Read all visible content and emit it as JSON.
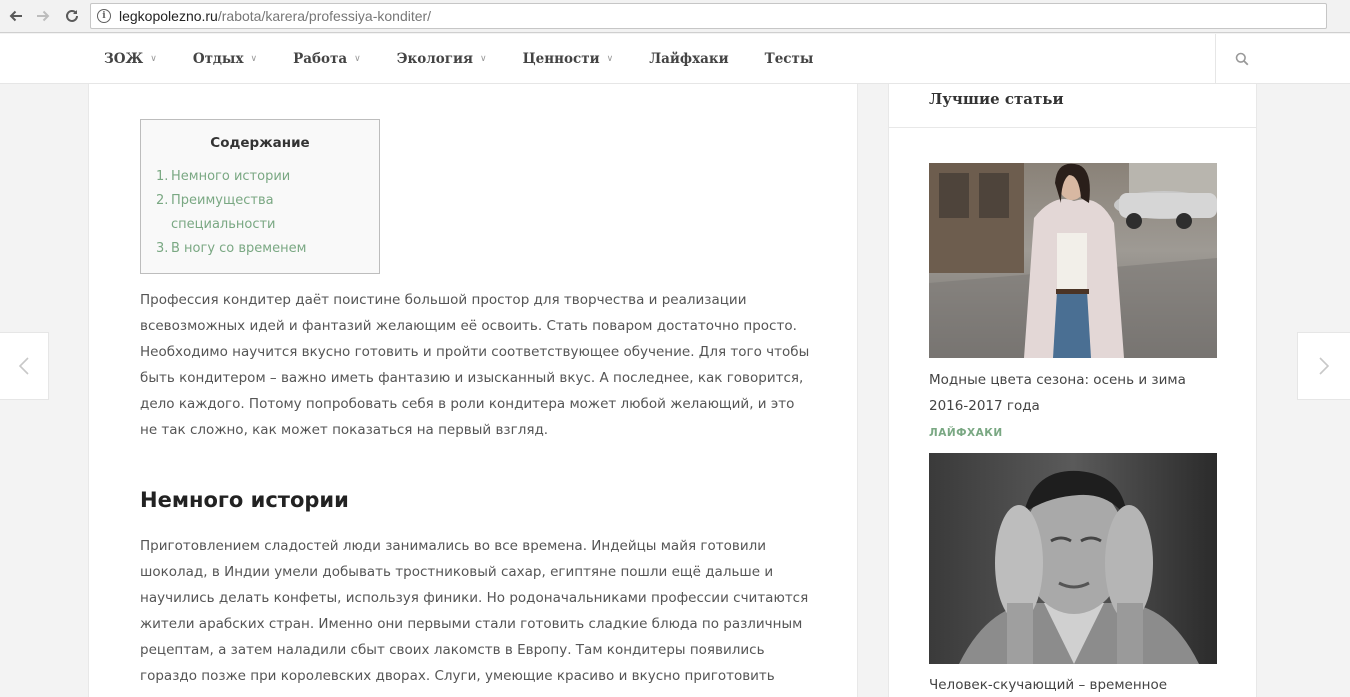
{
  "browser": {
    "url_domain": "legkopolezno.ru",
    "url_path": "/rabota/karera/professiya-konditer/",
    "info_glyph": "i"
  },
  "menu": [
    {
      "label": "ЗОЖ",
      "chevron": "∨"
    },
    {
      "label": "Отдых",
      "chevron": "∨"
    },
    {
      "label": "Работа",
      "chevron": "∨"
    },
    {
      "label": "Экология",
      "chevron": "∨"
    },
    {
      "label": "Ценности",
      "chevron": "∨"
    },
    {
      "label": "Лайфхаки",
      "chevron": ""
    },
    {
      "label": "Тесты",
      "chevron": ""
    }
  ],
  "toc": {
    "title": "Содержание",
    "items": [
      {
        "num": "1.",
        "label": "Немного истории"
      },
      {
        "num": "2.",
        "label": "Преимущества специальности"
      },
      {
        "num": "3.",
        "label": "В ногу со временем"
      }
    ]
  },
  "article": {
    "intro": "Профессия кондитер даёт поистине большой простор для творчества и реализации всевозможных идей и фантазий желающим её освоить. Стать поваром достаточно просто. Необходимо научится вкусно готовить и пройти соответствующее обучение. Для того чтобы быть кондитером – важно иметь фантазию и изысканный вкус. А последнее, как говорится, дело каждого. Потому попробовать себя в роли кондитера может любой желающий, и это не так сложно, как может показаться на первый взгляд.",
    "heading": "Немного истории",
    "history": "Приготовлением сладостей люди занимались во все времена. Индейцы майя готовили шоколад, в Индии умели добывать тростниковый сахар, египтяне пошли ещё дальше и научились делать конфеты, используя финики. Но родоначальниками профессии считаются жители арабских стран. Именно они первыми стали готовить сладкие блюда по различным рецептам, а затем наладили сбыт своих лакомств в Европу. Там кондитеры появились гораздо позже при королевских дворах. Слуги, умеющие красиво и вкусно приготовить сладости для"
  },
  "sidebar": {
    "title": "Лучшие статьи",
    "cards": [
      {
        "title": "Модные цвета сезона: осень и зима 2016-2017 года",
        "category": "ЛАЙФХАКИ"
      },
      {
        "title": "Человек-скучающий – временное"
      }
    ]
  },
  "colors": {
    "accent_green": "#7aa883",
    "text": "#555555",
    "heading": "#222222"
  }
}
